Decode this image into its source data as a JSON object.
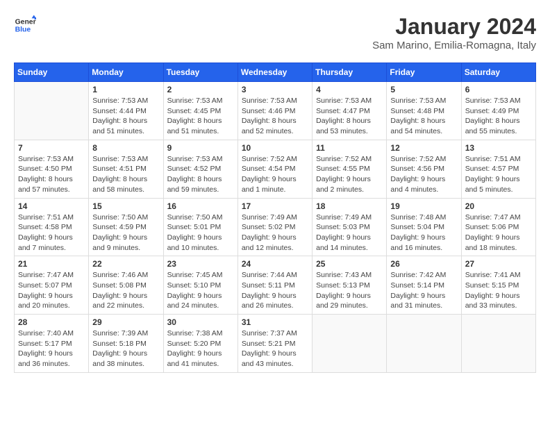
{
  "header": {
    "logo_general": "General",
    "logo_blue": "Blue",
    "title": "January 2024",
    "subtitle": "Sam Marino, Emilia-Romagna, Italy"
  },
  "days_of_week": [
    "Sunday",
    "Monday",
    "Tuesday",
    "Wednesday",
    "Thursday",
    "Friday",
    "Saturday"
  ],
  "weeks": [
    [
      {
        "day": "",
        "info": ""
      },
      {
        "day": "1",
        "info": "Sunrise: 7:53 AM\nSunset: 4:44 PM\nDaylight: 8 hours\nand 51 minutes."
      },
      {
        "day": "2",
        "info": "Sunrise: 7:53 AM\nSunset: 4:45 PM\nDaylight: 8 hours\nand 51 minutes."
      },
      {
        "day": "3",
        "info": "Sunrise: 7:53 AM\nSunset: 4:46 PM\nDaylight: 8 hours\nand 52 minutes."
      },
      {
        "day": "4",
        "info": "Sunrise: 7:53 AM\nSunset: 4:47 PM\nDaylight: 8 hours\nand 53 minutes."
      },
      {
        "day": "5",
        "info": "Sunrise: 7:53 AM\nSunset: 4:48 PM\nDaylight: 8 hours\nand 54 minutes."
      },
      {
        "day": "6",
        "info": "Sunrise: 7:53 AM\nSunset: 4:49 PM\nDaylight: 8 hours\nand 55 minutes."
      }
    ],
    [
      {
        "day": "7",
        "info": "Sunrise: 7:53 AM\nSunset: 4:50 PM\nDaylight: 8 hours\nand 57 minutes."
      },
      {
        "day": "8",
        "info": "Sunrise: 7:53 AM\nSunset: 4:51 PM\nDaylight: 8 hours\nand 58 minutes."
      },
      {
        "day": "9",
        "info": "Sunrise: 7:53 AM\nSunset: 4:52 PM\nDaylight: 8 hours\nand 59 minutes."
      },
      {
        "day": "10",
        "info": "Sunrise: 7:52 AM\nSunset: 4:54 PM\nDaylight: 9 hours\nand 1 minute."
      },
      {
        "day": "11",
        "info": "Sunrise: 7:52 AM\nSunset: 4:55 PM\nDaylight: 9 hours\nand 2 minutes."
      },
      {
        "day": "12",
        "info": "Sunrise: 7:52 AM\nSunset: 4:56 PM\nDaylight: 9 hours\nand 4 minutes."
      },
      {
        "day": "13",
        "info": "Sunrise: 7:51 AM\nSunset: 4:57 PM\nDaylight: 9 hours\nand 5 minutes."
      }
    ],
    [
      {
        "day": "14",
        "info": "Sunrise: 7:51 AM\nSunset: 4:58 PM\nDaylight: 9 hours\nand 7 minutes."
      },
      {
        "day": "15",
        "info": "Sunrise: 7:50 AM\nSunset: 4:59 PM\nDaylight: 9 hours\nand 9 minutes."
      },
      {
        "day": "16",
        "info": "Sunrise: 7:50 AM\nSunset: 5:01 PM\nDaylight: 9 hours\nand 10 minutes."
      },
      {
        "day": "17",
        "info": "Sunrise: 7:49 AM\nSunset: 5:02 PM\nDaylight: 9 hours\nand 12 minutes."
      },
      {
        "day": "18",
        "info": "Sunrise: 7:49 AM\nSunset: 5:03 PM\nDaylight: 9 hours\nand 14 minutes."
      },
      {
        "day": "19",
        "info": "Sunrise: 7:48 AM\nSunset: 5:04 PM\nDaylight: 9 hours\nand 16 minutes."
      },
      {
        "day": "20",
        "info": "Sunrise: 7:47 AM\nSunset: 5:06 PM\nDaylight: 9 hours\nand 18 minutes."
      }
    ],
    [
      {
        "day": "21",
        "info": "Sunrise: 7:47 AM\nSunset: 5:07 PM\nDaylight: 9 hours\nand 20 minutes."
      },
      {
        "day": "22",
        "info": "Sunrise: 7:46 AM\nSunset: 5:08 PM\nDaylight: 9 hours\nand 22 minutes."
      },
      {
        "day": "23",
        "info": "Sunrise: 7:45 AM\nSunset: 5:10 PM\nDaylight: 9 hours\nand 24 minutes."
      },
      {
        "day": "24",
        "info": "Sunrise: 7:44 AM\nSunset: 5:11 PM\nDaylight: 9 hours\nand 26 minutes."
      },
      {
        "day": "25",
        "info": "Sunrise: 7:43 AM\nSunset: 5:13 PM\nDaylight: 9 hours\nand 29 minutes."
      },
      {
        "day": "26",
        "info": "Sunrise: 7:42 AM\nSunset: 5:14 PM\nDaylight: 9 hours\nand 31 minutes."
      },
      {
        "day": "27",
        "info": "Sunrise: 7:41 AM\nSunset: 5:15 PM\nDaylight: 9 hours\nand 33 minutes."
      }
    ],
    [
      {
        "day": "28",
        "info": "Sunrise: 7:40 AM\nSunset: 5:17 PM\nDaylight: 9 hours\nand 36 minutes."
      },
      {
        "day": "29",
        "info": "Sunrise: 7:39 AM\nSunset: 5:18 PM\nDaylight: 9 hours\nand 38 minutes."
      },
      {
        "day": "30",
        "info": "Sunrise: 7:38 AM\nSunset: 5:20 PM\nDaylight: 9 hours\nand 41 minutes."
      },
      {
        "day": "31",
        "info": "Sunrise: 7:37 AM\nSunset: 5:21 PM\nDaylight: 9 hours\nand 43 minutes."
      },
      {
        "day": "",
        "info": ""
      },
      {
        "day": "",
        "info": ""
      },
      {
        "day": "",
        "info": ""
      }
    ]
  ]
}
